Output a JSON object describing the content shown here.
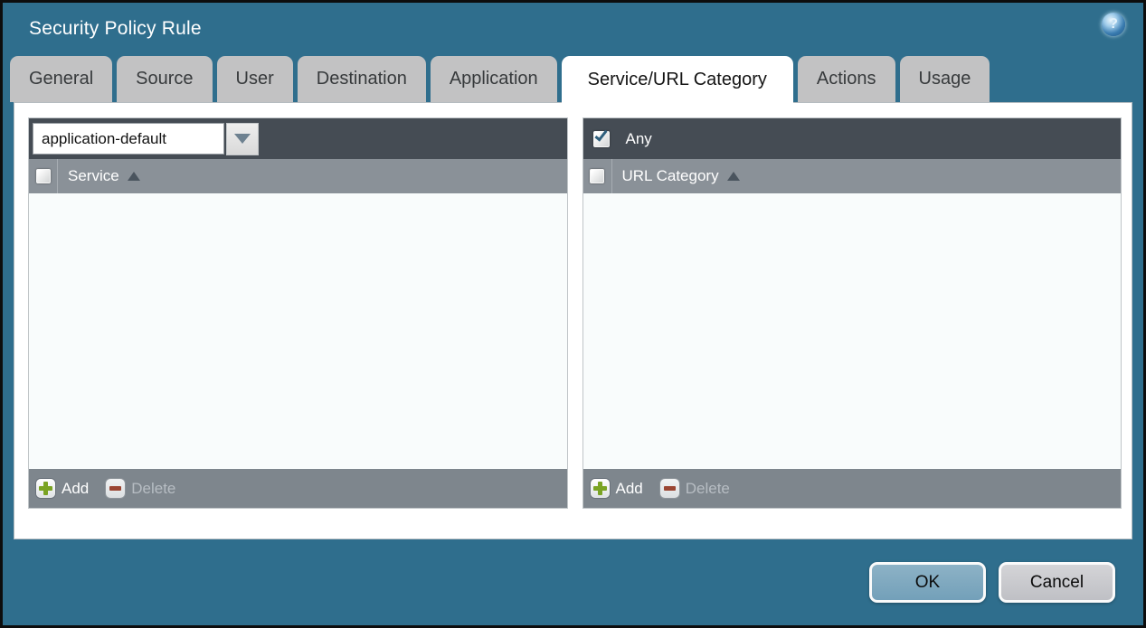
{
  "window": {
    "title": "Security Policy Rule"
  },
  "tabs": [
    {
      "label": "General",
      "active": false
    },
    {
      "label": "Source",
      "active": false
    },
    {
      "label": "User",
      "active": false
    },
    {
      "label": "Destination",
      "active": false
    },
    {
      "label": "Application",
      "active": false
    },
    {
      "label": "Service/URL Category",
      "active": true
    },
    {
      "label": "Actions",
      "active": false
    },
    {
      "label": "Usage",
      "active": false
    }
  ],
  "service_panel": {
    "dropdown": {
      "value": "application-default"
    },
    "table": {
      "column_header": "Service",
      "sort": "asc",
      "rows": []
    },
    "toolbar": {
      "add_label": "Add",
      "delete_label": "Delete",
      "delete_enabled": false
    }
  },
  "url_category_panel": {
    "any": {
      "label": "Any",
      "checked": true
    },
    "table": {
      "column_header": "URL Category",
      "sort": "asc",
      "rows": []
    },
    "toolbar": {
      "add_label": "Add",
      "delete_label": "Delete",
      "delete_enabled": false
    }
  },
  "dialog_buttons": {
    "ok_label": "OK",
    "cancel_label": "Cancel"
  },
  "icons": {
    "help": "help-icon",
    "dropdown": "chevron-down-icon",
    "sort": "sort-asc-icon",
    "add": "plus-icon",
    "delete": "minus-icon",
    "checked": "checkmark-icon"
  },
  "colors": {
    "background_teal": "#2f6e8d",
    "title_text": "#ffffff",
    "tab_inactive": "#c2c2c3",
    "tab_active": "#ffffff",
    "toolbar_dark": "#454c54",
    "table_header": "#8a9198",
    "table_body": "#f9fcfc",
    "panel_footer": "#7e868d",
    "add_green": "#7aa323",
    "delete_red": "#9a4532",
    "checkmark_teal": "#2e5f7d",
    "ok_button": "#7ea8bf",
    "cancel_button": "#c7c7cb",
    "help_blue": "#2a6ea6"
  }
}
